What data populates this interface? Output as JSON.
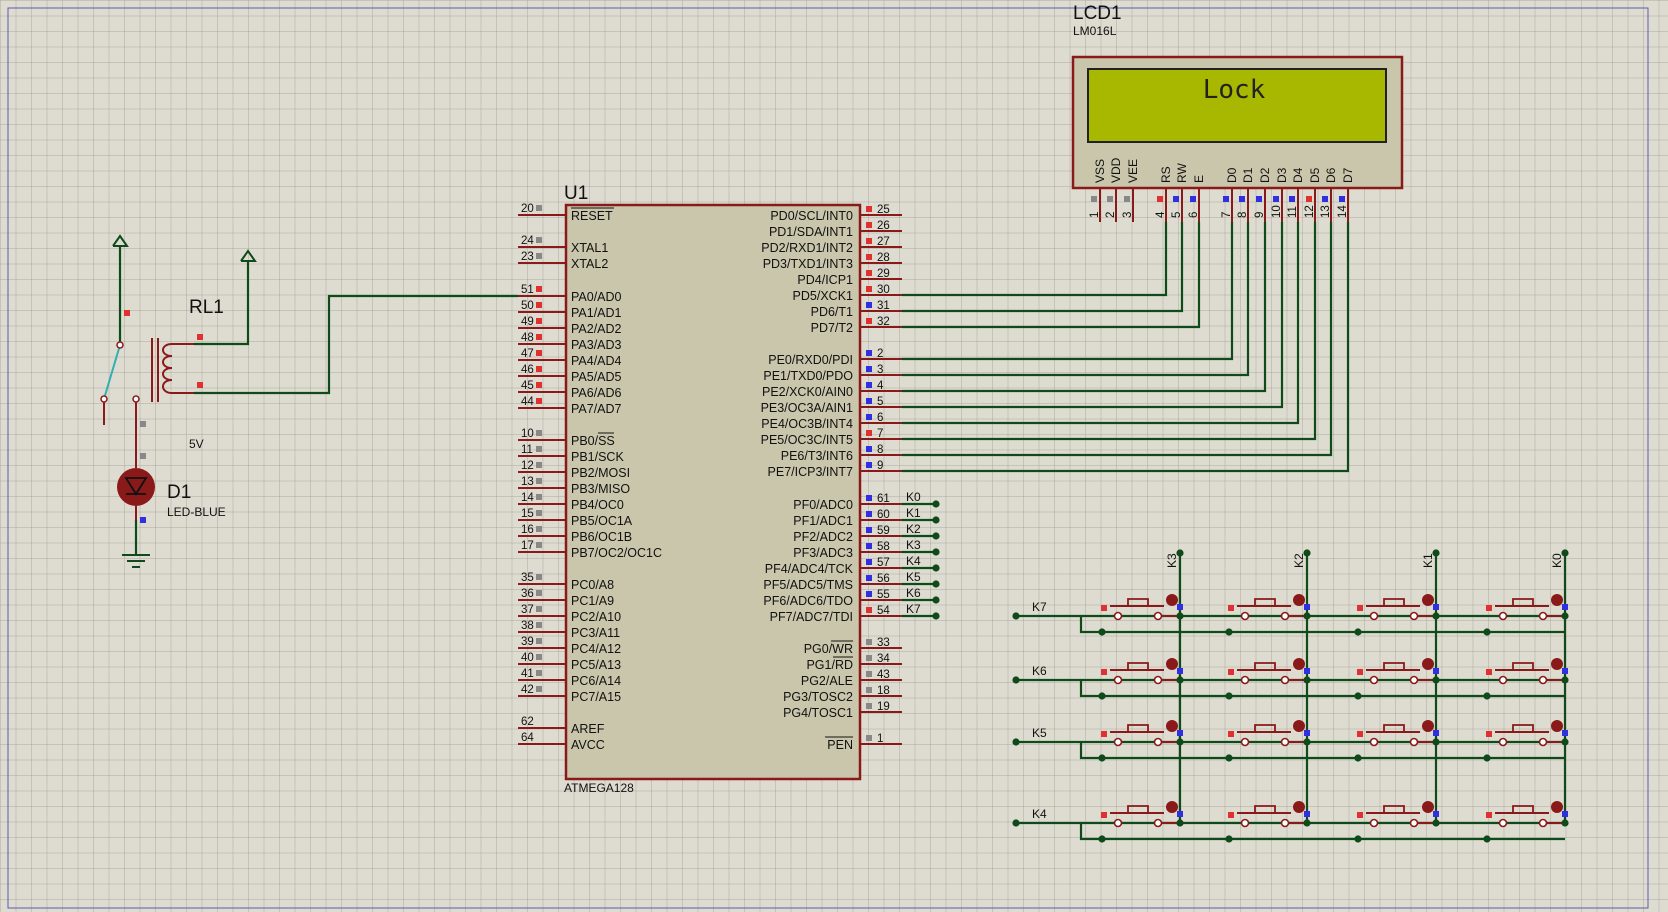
{
  "mcu": {
    "ref": "U1",
    "part": "ATMEGA128",
    "left_pins": [
      {
        "num": "20",
        "name": "RESET"
      },
      {
        "num": "24",
        "name": "XTAL1"
      },
      {
        "num": "23",
        "name": "XTAL2"
      },
      {
        "num": "51",
        "name": "PA0/AD0"
      },
      {
        "num": "50",
        "name": "PA1/AD1"
      },
      {
        "num": "49",
        "name": "PA2/AD2"
      },
      {
        "num": "48",
        "name": "PA3/AD3"
      },
      {
        "num": "47",
        "name": "PA4/AD4"
      },
      {
        "num": "46",
        "name": "PA5/AD5"
      },
      {
        "num": "45",
        "name": "PA6/AD6"
      },
      {
        "num": "44",
        "name": "PA7/AD7"
      },
      {
        "num": "10",
        "name": "PB0/SS"
      },
      {
        "num": "11",
        "name": "PB1/SCK"
      },
      {
        "num": "12",
        "name": "PB2/MOSI"
      },
      {
        "num": "13",
        "name": "PB3/MISO"
      },
      {
        "num": "14",
        "name": "PB4/OC0"
      },
      {
        "num": "15",
        "name": "PB5/OC1A"
      },
      {
        "num": "16",
        "name": "PB6/OC1B"
      },
      {
        "num": "17",
        "name": "PB7/OC2/OC1C"
      },
      {
        "num": "35",
        "name": "PC0/A8"
      },
      {
        "num": "36",
        "name": "PC1/A9"
      },
      {
        "num": "37",
        "name": "PC2/A10"
      },
      {
        "num": "38",
        "name": "PC3/A11"
      },
      {
        "num": "39",
        "name": "PC4/A12"
      },
      {
        "num": "40",
        "name": "PC5/A13"
      },
      {
        "num": "41",
        "name": "PC6/A14"
      },
      {
        "num": "42",
        "name": "PC7/A15"
      },
      {
        "num": "62",
        "name": "AREF"
      },
      {
        "num": "64",
        "name": "AVCC"
      }
    ],
    "right_pins": [
      {
        "num": "25",
        "name": "PD0/SCL/INT0"
      },
      {
        "num": "26",
        "name": "PD1/SDA/INT1"
      },
      {
        "num": "27",
        "name": "PD2/RXD1/INT2"
      },
      {
        "num": "28",
        "name": "PD3/TXD1/INT3"
      },
      {
        "num": "29",
        "name": "PD4/ICP1"
      },
      {
        "num": "30",
        "name": "PD5/XCK1"
      },
      {
        "num": "31",
        "name": "PD6/T1"
      },
      {
        "num": "32",
        "name": "PD7/T2"
      },
      {
        "num": "2",
        "name": "PE0/RXD0/PDI"
      },
      {
        "num": "3",
        "name": "PE1/TXD0/PDO"
      },
      {
        "num": "4",
        "name": "PE2/XCK0/AIN0"
      },
      {
        "num": "5",
        "name": "PE3/OC3A/AIN1"
      },
      {
        "num": "6",
        "name": "PE4/OC3B/INT4"
      },
      {
        "num": "7",
        "name": "PE5/OC3C/INT5"
      },
      {
        "num": "8",
        "name": "PE6/T3/INT6"
      },
      {
        "num": "9",
        "name": "PE7/ICP3/INT7"
      },
      {
        "num": "61",
        "name": "PF0/ADC0"
      },
      {
        "num": "60",
        "name": "PF1/ADC1"
      },
      {
        "num": "59",
        "name": "PF2/ADC2"
      },
      {
        "num": "58",
        "name": "PF3/ADC3"
      },
      {
        "num": "57",
        "name": "PF4/ADC4/TCK"
      },
      {
        "num": "56",
        "name": "PF5/ADC5/TMS"
      },
      {
        "num": "55",
        "name": "PF6/ADC6/TDO"
      },
      {
        "num": "54",
        "name": "PF7/ADC7/TDI"
      },
      {
        "num": "33",
        "name": "PG0/WR"
      },
      {
        "num": "34",
        "name": "PG1/RD"
      },
      {
        "num": "43",
        "name": "PG2/ALE"
      },
      {
        "num": "18",
        "name": "PG3/TOSC2"
      },
      {
        "num": "19",
        "name": "PG4/TOSC1"
      },
      {
        "num": "1",
        "name": "PEN"
      }
    ],
    "keypad_net_labels": [
      "K0",
      "K1",
      "K2",
      "K3",
      "K4",
      "K5",
      "K6",
      "K7"
    ]
  },
  "lcd": {
    "ref": "LCD1",
    "part": "LM016L",
    "display_text": "Lock",
    "pins": [
      {
        "num": "1",
        "name": "VSS"
      },
      {
        "num": "2",
        "name": "VDD"
      },
      {
        "num": "3",
        "name": "VEE"
      },
      {
        "num": "4",
        "name": "RS"
      },
      {
        "num": "5",
        "name": "RW"
      },
      {
        "num": "6",
        "name": "E"
      },
      {
        "num": "7",
        "name": "D0"
      },
      {
        "num": "8",
        "name": "D1"
      },
      {
        "num": "9",
        "name": "D2"
      },
      {
        "num": "10",
        "name": "D3"
      },
      {
        "num": "11",
        "name": "D4"
      },
      {
        "num": "12",
        "name": "D5"
      },
      {
        "num": "13",
        "name": "D6"
      },
      {
        "num": "14",
        "name": "D7"
      }
    ]
  },
  "relay": {
    "ref": "RL1",
    "value": "5V"
  },
  "led": {
    "ref": "D1",
    "part": "LED-BLUE"
  },
  "keypad": {
    "row_labels": [
      "K7",
      "K6",
      "K5",
      "K4"
    ],
    "col_labels": [
      "K3",
      "K2",
      "K1",
      "K0"
    ]
  },
  "colors": {
    "wire": "#0e4a1a",
    "body_outline": "#8a1a1a",
    "body_fill": "#c9c6ab",
    "lcd_screen": "#a8b800",
    "pin_red": "#e03030",
    "pin_blue": "#3030e0",
    "pin_gray": "#888888"
  }
}
